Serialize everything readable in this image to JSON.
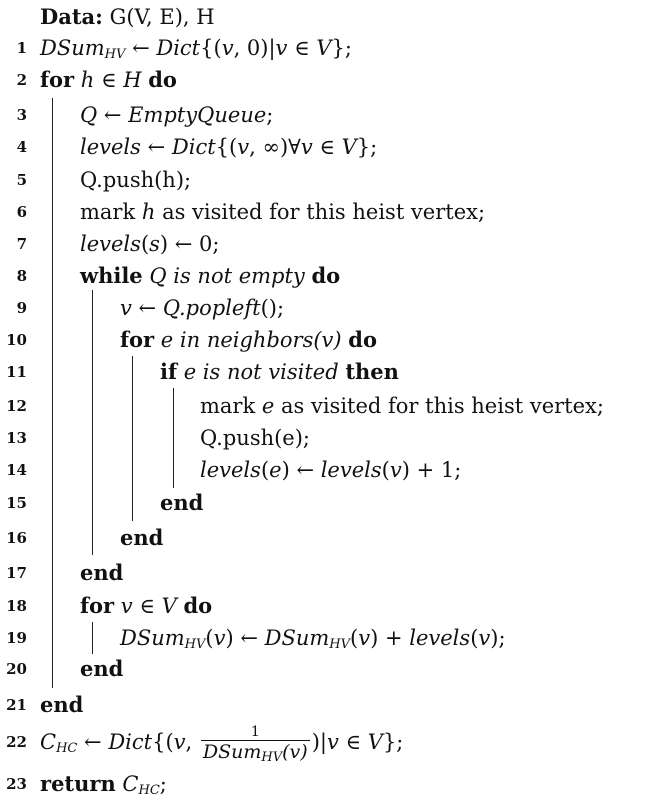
{
  "header": {
    "label": "Data:",
    "value": "G(V, E), H"
  },
  "lines": [
    {
      "n": "1",
      "text": "DSum_HV ← Dict{(v, 0)|v ∈ V};"
    },
    {
      "n": "2",
      "text": "for h ∈ H do"
    },
    {
      "n": "3",
      "text": "Q ← EmptyQueue;"
    },
    {
      "n": "4",
      "text": "levels ← Dict{(v, ∞)∀v ∈ V};"
    },
    {
      "n": "5",
      "text": "Q.push(h);"
    },
    {
      "n": "6",
      "text": "mark h as visited for this heist vertex;"
    },
    {
      "n": "7",
      "text": "levels(s) ← 0;"
    },
    {
      "n": "8",
      "text": "while Q is not empty do"
    },
    {
      "n": "9",
      "text": "v ← Q.popleft();"
    },
    {
      "n": "10",
      "text": "for e in neighbors(v) do"
    },
    {
      "n": "11",
      "text": "if e is not visited then"
    },
    {
      "n": "12",
      "text": "mark e as visited for this heist vertex;"
    },
    {
      "n": "13",
      "text": "Q.push(e);"
    },
    {
      "n": "14",
      "text": "levels(e) ← levels(v) + 1;"
    },
    {
      "n": "15",
      "text": "end"
    },
    {
      "n": "16",
      "text": "end"
    },
    {
      "n": "17",
      "text": "end"
    },
    {
      "n": "18",
      "text": "for v ∈ V do"
    },
    {
      "n": "19",
      "text": "DSum_HV(v) ← DSum_HV(v) + levels(v);"
    },
    {
      "n": "20",
      "text": "end"
    },
    {
      "n": "21",
      "text": "end"
    },
    {
      "n": "22",
      "text": "C_HC ← Dict{(v, 1/DSum_HV(v))|v ∈ V};"
    },
    {
      "n": "23",
      "text": "return C_HC;"
    }
  ]
}
